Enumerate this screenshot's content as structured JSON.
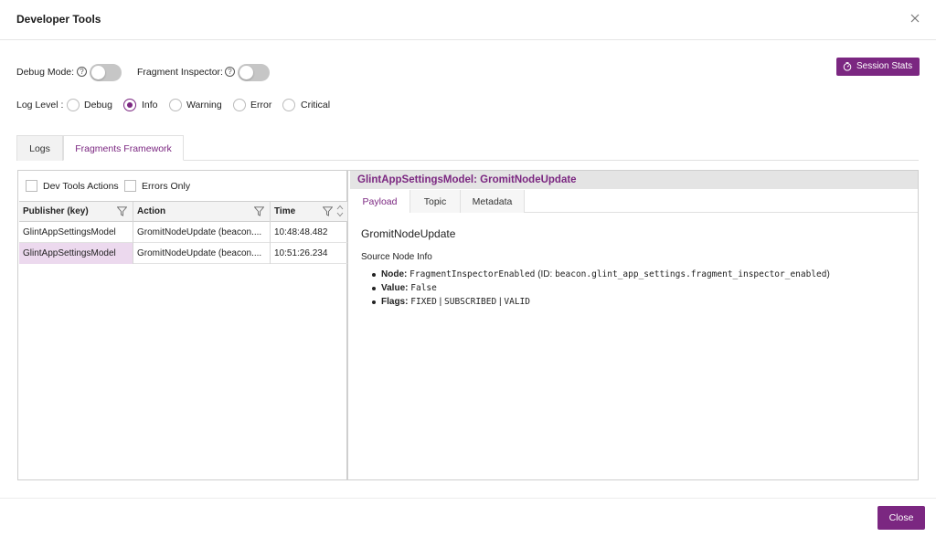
{
  "window": {
    "title": "Developer Tools"
  },
  "controls": {
    "debug_mode_label": "Debug Mode:",
    "fragment_inspector_label": "Fragment Inspector:",
    "help_glyph": "?",
    "debug_mode_on": false,
    "fragment_inspector_on": false,
    "session_stats_label": "Session Stats"
  },
  "log_level": {
    "label": "Log Level :",
    "options": [
      "Debug",
      "Info",
      "Warning",
      "Error",
      "Critical"
    ],
    "selected": "Info"
  },
  "tabs": [
    {
      "label": "Logs",
      "active": false
    },
    {
      "label": "Fragments Framework",
      "active": true
    }
  ],
  "filters": {
    "dev_tools_actions": "Dev Tools Actions",
    "errors_only": "Errors Only"
  },
  "grid": {
    "columns": [
      "Publisher (key)",
      "Action",
      "Time"
    ],
    "rows": [
      {
        "publisher": "GlintAppSettingsModel",
        "action": "GromitNodeUpdate (beacon....",
        "time": "10:48:48.482",
        "selected": false
      },
      {
        "publisher": "GlintAppSettingsModel",
        "action": "GromitNodeUpdate (beacon....",
        "time": "10:51:26.234",
        "selected": true
      }
    ]
  },
  "detail": {
    "title": "GlintAppSettingsModel: GromitNodeUpdate",
    "tabs": [
      "Payload",
      "Topic",
      "Metadata"
    ],
    "active_tab": "Payload",
    "payload_heading": "GromitNodeUpdate",
    "section_heading": "Source Node Info",
    "node": {
      "label": "Node:",
      "name": "FragmentInspectorEnabled",
      "id_prefix": "(ID:",
      "id": "beacon.glint_app_settings.fragment_inspector_enabled",
      "id_suffix": ")"
    },
    "value": {
      "label": "Value:",
      "value": "False"
    },
    "flags": {
      "label": "Flags:",
      "items": [
        "FIXED",
        "SUBSCRIBED",
        "VALID"
      ],
      "separator": "|"
    }
  },
  "footer": {
    "close_label": "Close"
  },
  "colors": {
    "accent": "#7b2781",
    "selected_row": "#ecd9ee",
    "toggle_off": "#c6c6c6"
  }
}
